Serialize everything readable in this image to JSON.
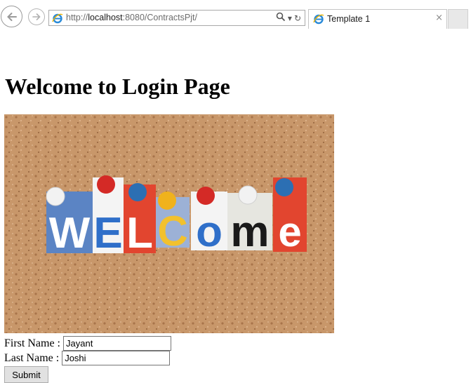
{
  "browser": {
    "url_prefix": "http://",
    "url_host": "localhost",
    "url_rest": ":8080/ContractsPjt/",
    "tab_title": "Template 1",
    "tab_close": "×",
    "search_glyph": "⚲",
    "dropdown_glyph": "▾",
    "refresh_glyph": "↻"
  },
  "page": {
    "heading": "Welcome to Login Page",
    "image_letters": [
      "W",
      "E",
      "L",
      "C",
      "o",
      "m",
      "e"
    ],
    "form": {
      "first_name_label": "First Name :",
      "first_name_value": "Jayant",
      "last_name_label": "Last Name :",
      "last_name_value": "Joshi",
      "submit_label": "Submit"
    }
  },
  "colors": {
    "cork": "#c8976a",
    "card_blue": "#5b84c4",
    "card_red": "#e2452f",
    "letter_blue": "#2f6fc9",
    "letter_yellow": "#f2c12e"
  }
}
